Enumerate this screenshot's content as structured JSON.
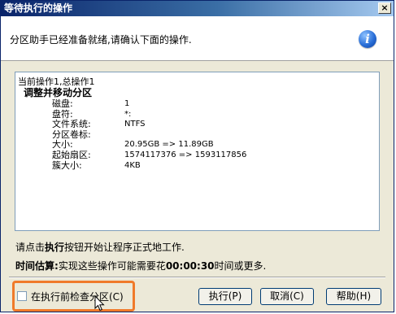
{
  "window": {
    "title": "等待执行的操作",
    "close": "×"
  },
  "header": {
    "text": "分区助手已经准备就绪,请确认下面的操作.",
    "icon": "info-icon",
    "icon_glyph": "i"
  },
  "operations": {
    "summary": "当前操作1,总操作1",
    "op_title": "调整并移动分区",
    "rows": [
      {
        "key": "磁盘:",
        "value": "1"
      },
      {
        "key": "盘符:",
        "value": "*:"
      },
      {
        "key": "文件系统:",
        "value": "NTFS"
      },
      {
        "key": "分区卷标:",
        "value": ""
      },
      {
        "key": "大小:",
        "value": "20.95GB => 11.89GB"
      },
      {
        "key": "起始扇区:",
        "value": "1574117376 => 1593117856"
      },
      {
        "key": "簇大小:",
        "value": "4KB"
      }
    ]
  },
  "notes": {
    "line1_pre": "请点击",
    "line1_bold": "执行",
    "line1_post": "按钮开始让程序正式地工作.",
    "line2_label": "时间估算:",
    "line2_pre": "实现这些操作可能需要花",
    "line2_time": "00:00:30",
    "line2_post": "时间或更多."
  },
  "checkbox": {
    "label": "在执行前检查分区(C)",
    "checked": false
  },
  "buttons": {
    "execute": "执行(P)",
    "cancel": "取消(C)",
    "help": "帮助(H)"
  },
  "colors": {
    "highlight": "#f07a2a",
    "titlebar": "#0a246a",
    "info_icon": "#2a6fd8"
  }
}
